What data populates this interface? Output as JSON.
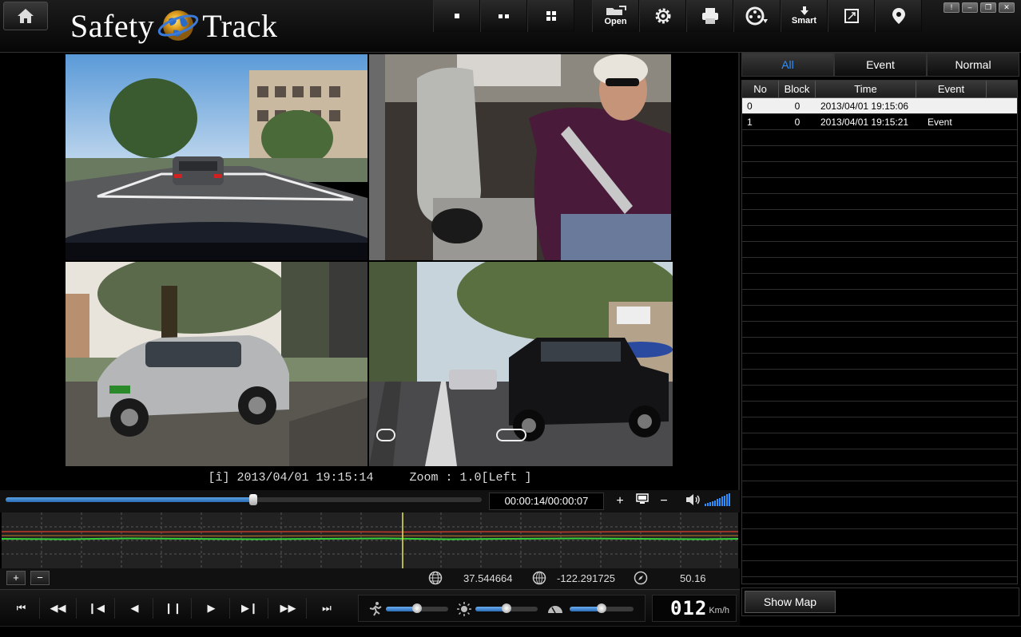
{
  "app": {
    "logo_left": "Safety",
    "logo_right": "Track"
  },
  "toolbar": {
    "open_label": "Open",
    "smart_label": "Smart"
  },
  "osd": {
    "text": "[î] 2013/04/01 19:15:14     Zoom : 1.0[Left ]"
  },
  "playback": {
    "time_display": "00:00:14/00:00:07",
    "progress_fraction": 0.52,
    "zoom_in_label": "+",
    "zoom_out_label": "−"
  },
  "coords": {
    "latitude": "37.544664",
    "longitude": "-122.291725",
    "heading": "50.16",
    "graph_plus": "+",
    "graph_minus": "−"
  },
  "sliders": {
    "sensor_level": 0.5,
    "brightness_level": 0.5,
    "volume_level": 0.5
  },
  "speed": {
    "value": "012",
    "unit": "Km/h"
  },
  "right_panel": {
    "tabs": [
      "All",
      "Event",
      "Normal"
    ],
    "active_tab": "All",
    "columns": [
      "No",
      "Block",
      "Time",
      "Event"
    ],
    "rows": [
      {
        "no": "0",
        "block": "0",
        "time": "2013/04/01 19:15:06",
        "event": ""
      },
      {
        "no": "1",
        "block": "0",
        "time": "2013/04/01 19:15:21",
        "event": "Event"
      }
    ],
    "show_map_label": "Show Map"
  },
  "colors": {
    "accent": "#2e8fff",
    "graph_green": "#37d03a",
    "graph_red": "#c0392b",
    "cursor_yellow": "#e8e85a"
  }
}
